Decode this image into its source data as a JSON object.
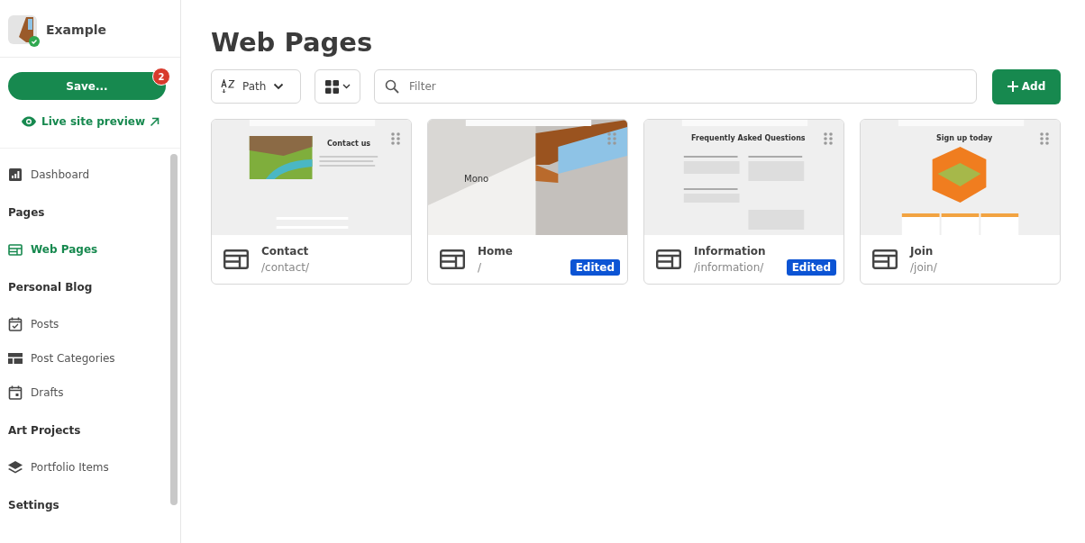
{
  "site": {
    "name": "Example",
    "verified": true
  },
  "save_button": {
    "label": "Save...",
    "badge": "2"
  },
  "preview_link": "Live site preview",
  "sidebar": [
    {
      "kind": "item",
      "label": "Dashboard",
      "selected": false
    },
    {
      "kind": "heading",
      "label": "Pages"
    },
    {
      "kind": "item",
      "label": "Web Pages",
      "selected": true
    },
    {
      "kind": "heading",
      "label": "Personal Blog"
    },
    {
      "kind": "item",
      "label": "Posts",
      "selected": false
    },
    {
      "kind": "item",
      "label": "Post Categories",
      "selected": false
    },
    {
      "kind": "item",
      "label": "Drafts",
      "selected": false
    },
    {
      "kind": "heading",
      "label": "Art Projects"
    },
    {
      "kind": "item",
      "label": "Portfolio Items",
      "selected": false
    },
    {
      "kind": "heading",
      "label": "Settings"
    }
  ],
  "title": "Web Pages",
  "sort": {
    "label": "Path"
  },
  "filter": {
    "placeholder": "Filter"
  },
  "add_button": "Add",
  "pages": [
    {
      "name": "Contact",
      "path": "/contact/",
      "preview": {
        "kind": "contact",
        "heading": "Contact us"
      }
    },
    {
      "name": "Home",
      "path": "/",
      "badge": "Edited",
      "preview": {
        "heading": "Mono"
      }
    },
    {
      "name": "Information",
      "path": "/information/",
      "badge": "Edited",
      "preview": {
        "kind": "faq",
        "heading": "Frequently Asked Questions"
      }
    },
    {
      "name": "Join",
      "path": "/join/",
      "preview": {
        "kind": "signup",
        "heading": "Sign up today"
      }
    }
  ]
}
